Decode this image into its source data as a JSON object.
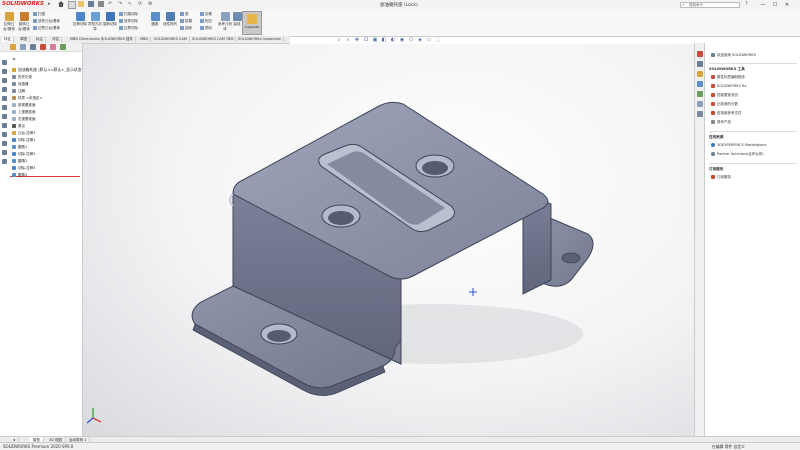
{
  "app": {
    "logo_bold": "SOLIDWORKS",
    "logo_suffix": "",
    "window_title": "加油箱托座 (Lock)",
    "search_placeholder": "搜索命令",
    "window_buttons": [
      "—",
      "☐",
      "✕"
    ]
  },
  "ribbon": {
    "big_buttons": [
      {
        "label": "拉伸凸台/基体",
        "color": "#d9a23a"
      },
      {
        "label": "旋转凸台/基体",
        "color": "#c97f2e"
      },
      {
        "label": "拉伸切除",
        "color": "#4d86c6"
      },
      {
        "label": "异型孔向导",
        "color": "#6aa0d6"
      },
      {
        "label": "旋转切除",
        "color": "#3e76b8"
      },
      {
        "label": "圆角",
        "color": "#5b8fc9"
      },
      {
        "label": "线性阵列",
        "color": "#4f7fb5"
      },
      {
        "label": "筋",
        "color": "#7b8ea8"
      },
      {
        "label": "参考几何体",
        "color": "#8aa1bd"
      },
      {
        "label": "曲线",
        "color": "#6f8db0"
      }
    ],
    "small_items": [
      {
        "label": "扫描"
      },
      {
        "label": "放样凸台/基体"
      },
      {
        "label": "边界凸台/基体"
      },
      {
        "label": "扫描切除"
      },
      {
        "label": "放样切除"
      },
      {
        "label": "边界切除"
      },
      {
        "label": "拔模"
      },
      {
        "label": "包覆"
      },
      {
        "label": "抽壳"
      },
      {
        "label": "相交"
      },
      {
        "label": "镜向"
      }
    ],
    "instant3d_label": "Instant3D"
  },
  "command_tabs": [
    "特征",
    "草图",
    "标注",
    "评估",
    "MBD Dimensions",
    "SOLIDWORKS 插件",
    "MBD",
    "SOLIDWORKS CAM",
    "SOLIDWORKS CAM TBM",
    "SOLIDWORKS Inspection"
  ],
  "active_tab_index": 0,
  "view_toolbar": [
    "⌕",
    "⌕",
    "✥",
    "⊡",
    "▣",
    "◧",
    "◐",
    "◉",
    "⬡",
    "◈",
    "▭",
    "⬚"
  ],
  "feature_tree": {
    "filter_label": "",
    "root": "加油箱托座 (默认<<默认>_显示状态 1>)",
    "items": [
      {
        "label": "历史记录",
        "color": "#7a8aa0"
      },
      {
        "label": "传感器",
        "color": "#7a8aa0"
      },
      {
        "label": "注解",
        "color": "#7a8aa0"
      },
      {
        "label": "材质 <未指定>",
        "color": "#b98b4c"
      },
      {
        "label": "前视基准面",
        "color": "#9ab0cc"
      },
      {
        "label": "上视基准面",
        "color": "#9ab0cc"
      },
      {
        "label": "右视基准面",
        "color": "#9ab0cc"
      },
      {
        "label": "原点",
        "color": "#555555"
      },
      {
        "label": "凸台-拉伸1",
        "color": "#d9a23a"
      },
      {
        "label": "切除-拉伸1",
        "color": "#4d86c6"
      },
      {
        "label": "圆角1",
        "color": "#5b8fc9"
      },
      {
        "label": "切除-拉伸2",
        "color": "#4d86c6"
      },
      {
        "label": "圆角2",
        "color": "#5b8fc9"
      },
      {
        "label": "切除-拉伸3",
        "color": "#4d86c6"
      },
      {
        "label": "圆角3",
        "color": "#5b8fc9"
      }
    ]
  },
  "task_pane": {
    "welcome": "欢迎使用 SOLIDWORKS",
    "tools_header": "SOLIDWORKS 工具",
    "tools": [
      "属性标签编制程序",
      "SOLIDWORKS Rx",
      "性能基准测试",
      "比较我的分数",
      "查找被参考文件",
      "操作产品"
    ],
    "resources_header": "在线资源",
    "resources": [
      "3DEXPERIENCE Marketplace",
      "Partner Solutions(合作伙伴)"
    ],
    "subscription_header": "订阅服务",
    "subscription": [
      "订阅服务"
    ]
  },
  "bottom_tabs": [
    "模型",
    "3D 视图",
    "运动算例 1"
  ],
  "active_bottom_tab": 0,
  "status": {
    "left": "SOLIDWORKS Premium 2020 SP0.0",
    "right": "在编辑 零件    自定义"
  },
  "colors": {
    "part_top": "#8c93a8",
    "part_side": "#6a7188",
    "part_dark": "#4c5266",
    "accent_red": "#d22222"
  }
}
